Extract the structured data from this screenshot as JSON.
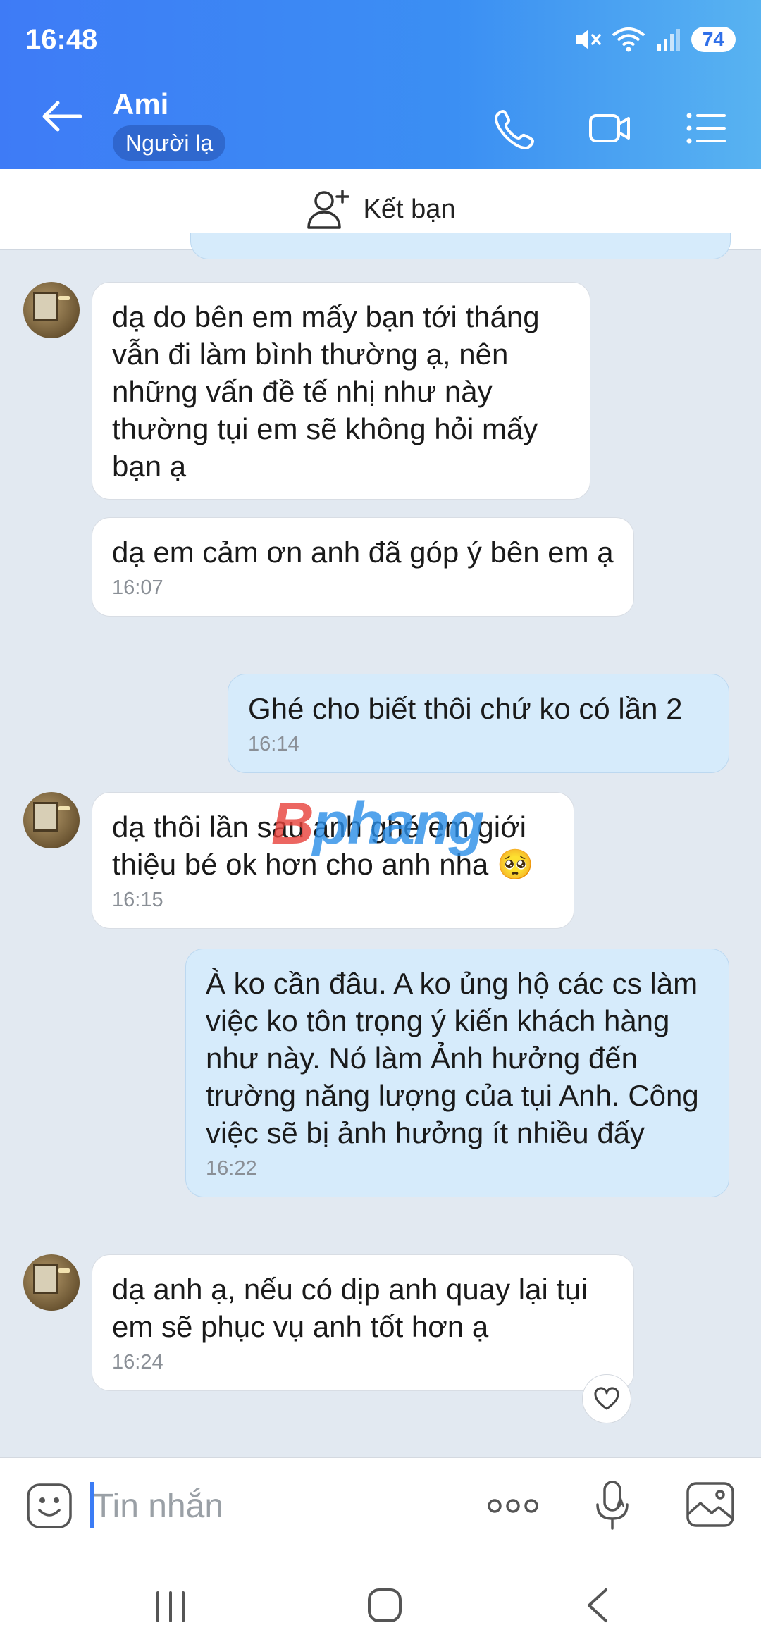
{
  "status_bar": {
    "time": "16:48",
    "battery": "74"
  },
  "header": {
    "contact_name": "Ami",
    "badge": "Người lạ"
  },
  "friend_bar": {
    "label": "Kết bạn"
  },
  "messages": [
    {
      "direction": "in",
      "text": "dạ do bên em mấy bạn tới tháng vẫn đi làm bình thường ạ, nên những vấn đề tế nhị như này thường tụi em sẽ không hỏi mấy bạn ạ",
      "time": ""
    },
    {
      "direction": "in",
      "text": "dạ em cảm ơn anh đã góp ý bên em ạ",
      "time": "16:07"
    },
    {
      "direction": "out",
      "text": "Ghé cho biết thôi chứ ko có lần 2",
      "time": "16:14"
    },
    {
      "direction": "in",
      "text": "dạ thôi lần sau anh ghé em giới thiệu bé ok hơn cho anh nha 🥺",
      "time": "16:15"
    },
    {
      "direction": "out",
      "text": "À ko cần đâu. A ko ủng hộ các cs làm việc ko tôn trọng ý kiến khách hàng như này. Nó làm Ảnh hưởng đến trường năng lượng của tụi Anh. Công việc sẽ bị ảnh hưởng ít nhiều đấy",
      "time": "16:22"
    },
    {
      "direction": "in",
      "text": "dạ anh ạ, nếu có dịp anh quay lại tụi em sẽ phục vụ anh tốt hơn ạ",
      "time": "16:24"
    }
  ],
  "watermark": {
    "first": "B",
    "rest": "phang"
  },
  "input": {
    "placeholder": "Tin nhắn",
    "value": ""
  },
  "colors": {
    "header_start": "#3e7bf6",
    "header_end": "#58b3f1",
    "outgoing_bubble": "#d6ebfb",
    "incoming_bubble": "#ffffff",
    "chat_background": "#e2e9f1"
  }
}
